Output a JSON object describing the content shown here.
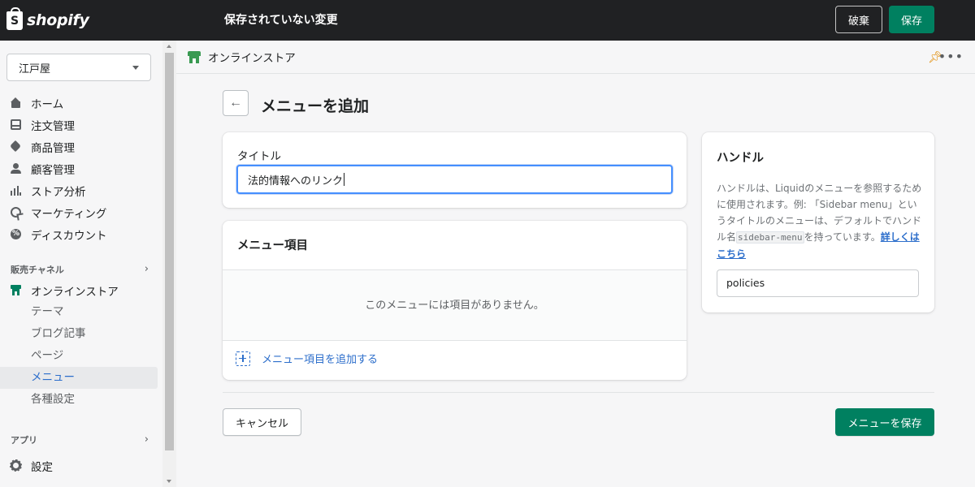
{
  "topbar": {
    "logo_mark": "S",
    "logo_text": "shopify",
    "unsaved_title": "保存されていない変更",
    "discard_label": "破棄",
    "save_label": "保存"
  },
  "sidebar": {
    "store_name": "江戸屋",
    "nav": [
      {
        "label": "ホーム",
        "icon": "home-icon"
      },
      {
        "label": "注文管理",
        "icon": "orders-icon"
      },
      {
        "label": "商品管理",
        "icon": "tag-icon"
      },
      {
        "label": "顧客管理",
        "icon": "person-icon"
      },
      {
        "label": "ストア分析",
        "icon": "bar-chart-icon"
      },
      {
        "label": "マーケティング",
        "icon": "target-icon"
      },
      {
        "label": "ディスカウント",
        "icon": "discount-icon"
      }
    ],
    "sales_channels_label": "販売チャネル",
    "online_store_label": "オンラインストア",
    "sub_items": [
      "テーマ",
      "ブログ記事",
      "ページ",
      "メニュー",
      "各種設定"
    ],
    "active_sub_item": "メニュー",
    "apps_label": "アプリ",
    "settings_label": "設定"
  },
  "main": {
    "channel_title": "オンラインストア",
    "pin_icon": "pin-icon",
    "more_icon": "more-actions-icon",
    "back_icon": "←",
    "page_title": "メニューを追加",
    "title_field": {
      "label": "タイトル",
      "value": "法的情報へのリンク"
    },
    "menu_items": {
      "heading": "メニュー項目",
      "empty_text": "このメニューには項目がありません。",
      "add_label": "メニュー項目を追加する"
    },
    "handle": {
      "heading": "ハンドル",
      "desc_part1": "ハンドルは、Liquidのメニューを参照するために使用されます。例: 「Sidebar menu」というタイトルのメニューは、デフォルトでハンドル名",
      "desc_code": "sidebar-menu",
      "desc_part2": "を持っています。",
      "learn_more": "詳しくはこちら",
      "value": "policies"
    },
    "cancel_label": "キャンセル",
    "save_menu_label": "メニューを保存"
  },
  "colors": {
    "topbar_bg": "#202123",
    "primary_green": "#008060",
    "link_blue": "#2c6ecb",
    "focus_blue": "#458fff"
  }
}
